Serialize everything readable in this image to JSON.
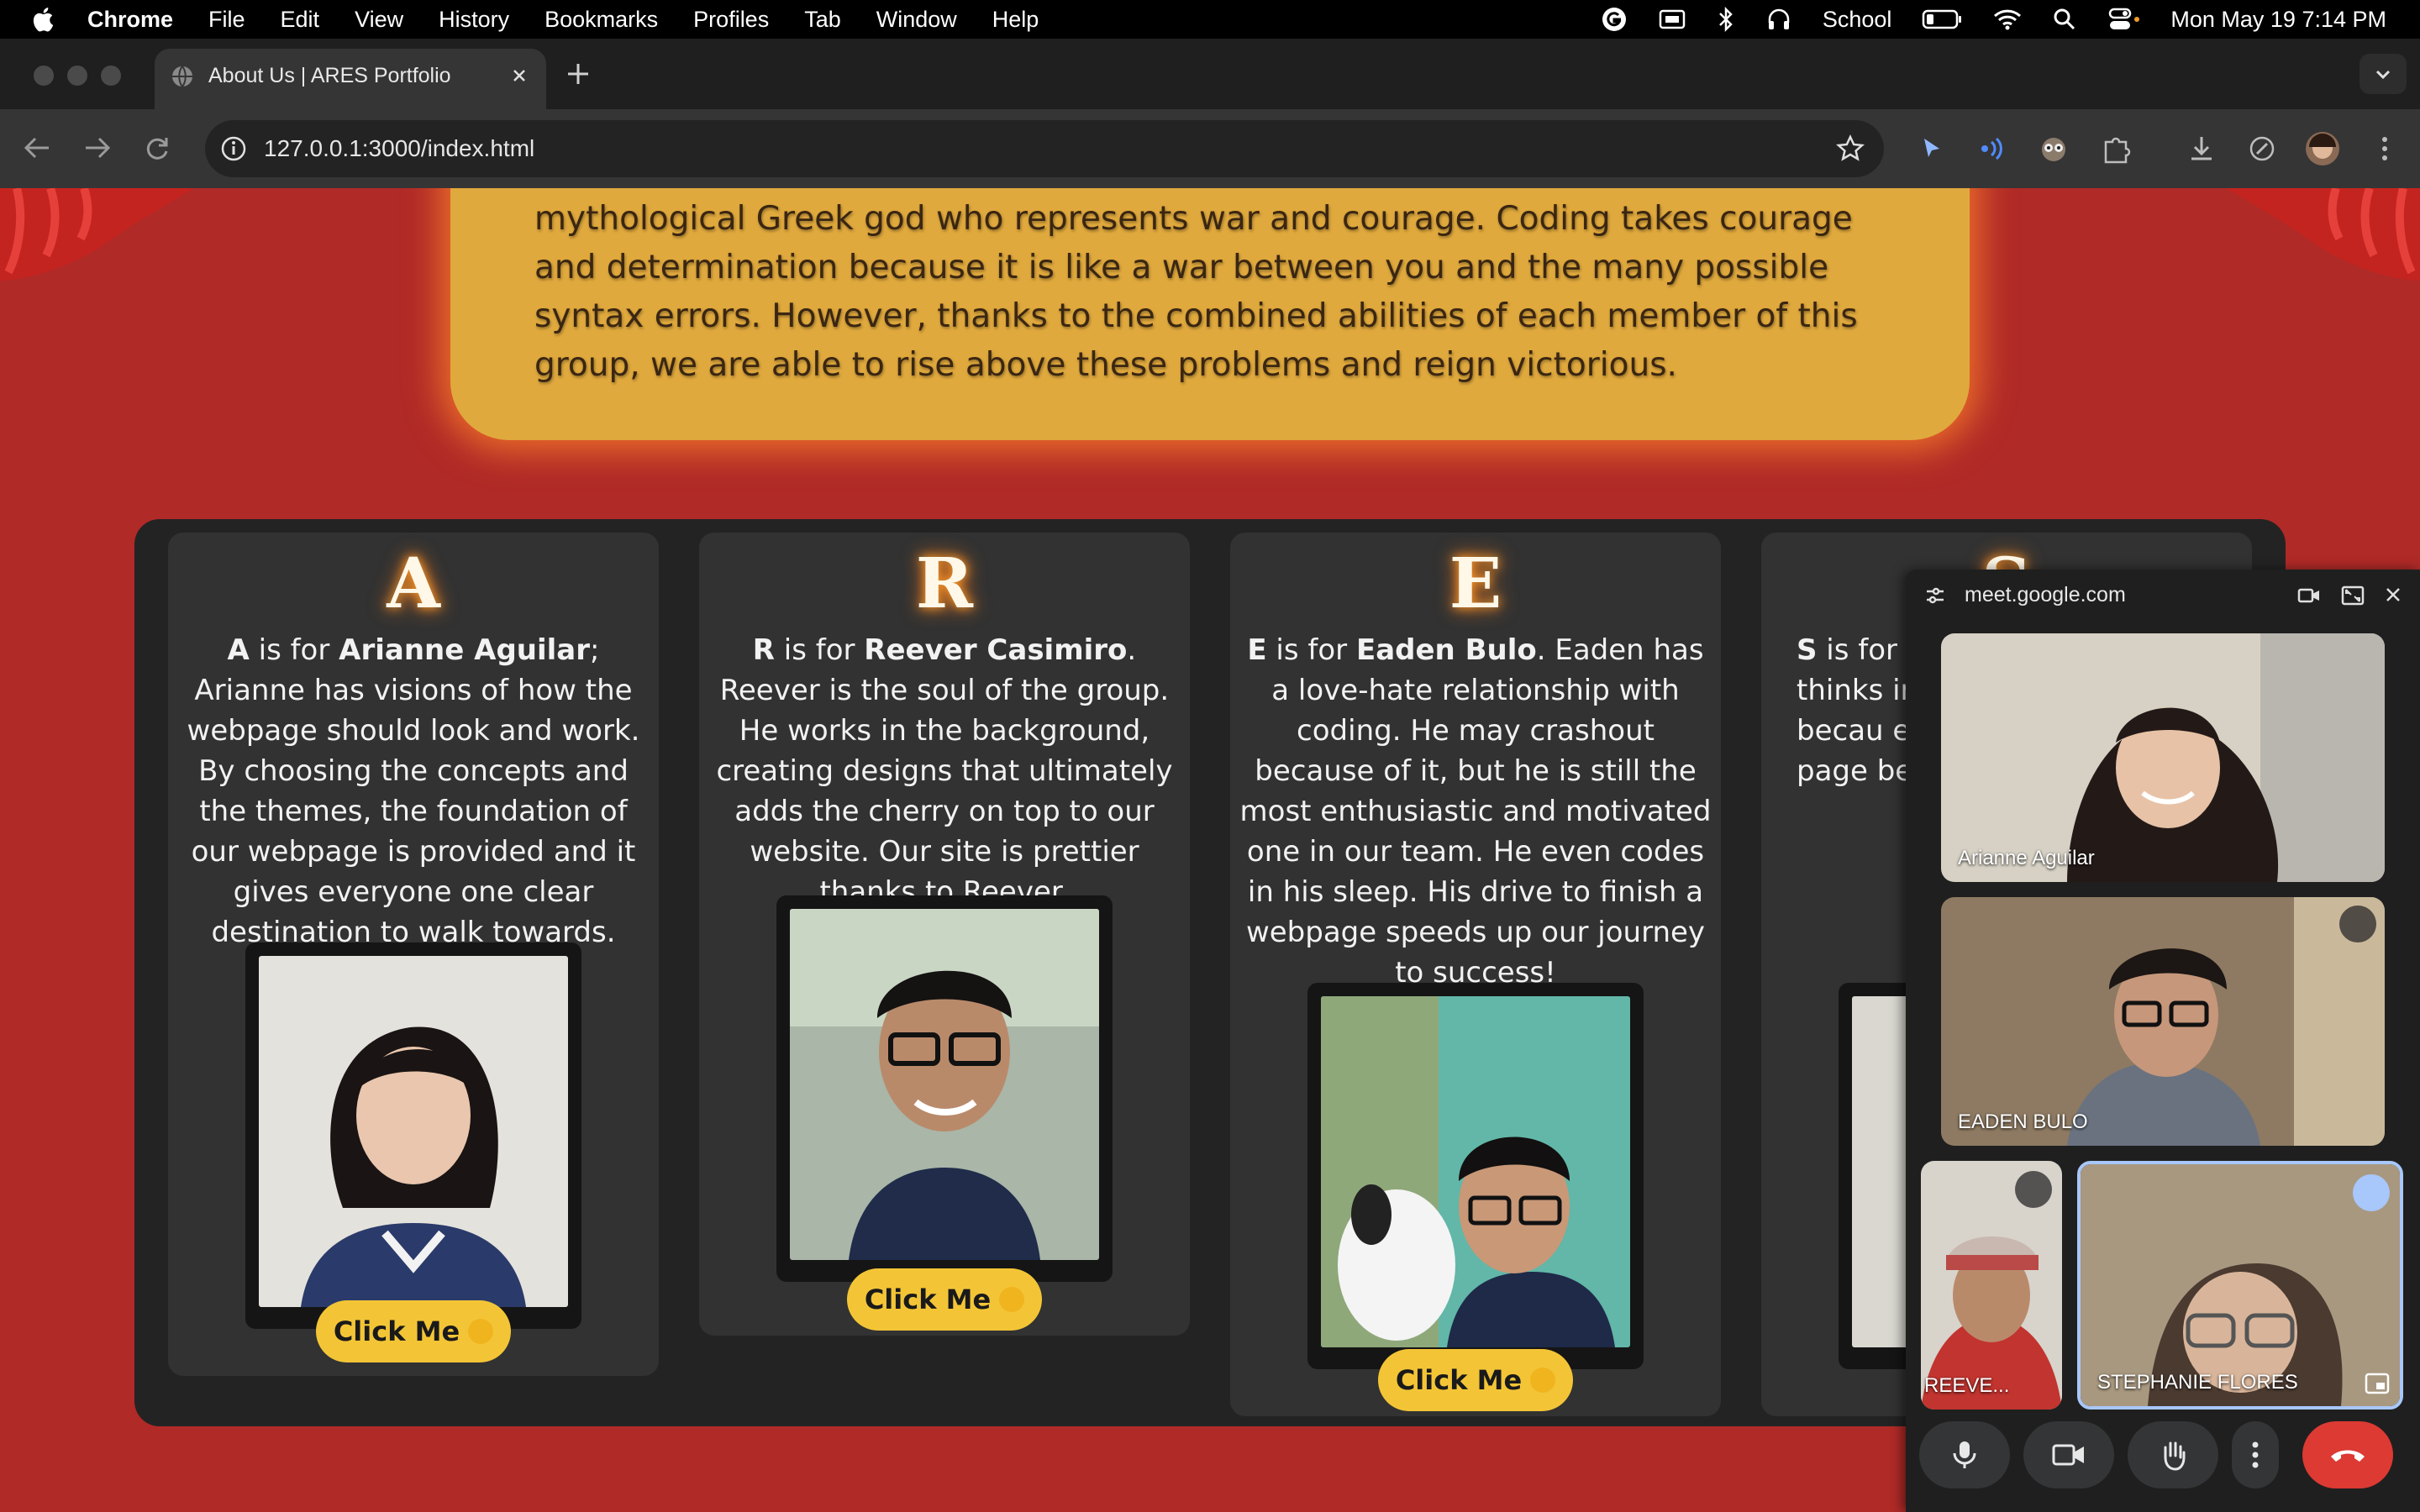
{
  "menubar": {
    "app": "Chrome",
    "items": [
      "File",
      "Edit",
      "View",
      "History",
      "Bookmarks",
      "Profiles",
      "Tab",
      "Window",
      "Help"
    ],
    "status_text": "School",
    "datetime": "Mon May 19  7:14 PM"
  },
  "browser": {
    "tab_title": "About Us | ARES Portfolio",
    "url": "127.0.0.1:3000/index.html"
  },
  "page": {
    "intro_text": "mythological Greek god who represents war and courage. Coding takes courage and determination because it is like a war between you and the many possible syntax errors. However, thanks to the combined abilities of each member of this group, we are able to rise above these problems and reign victorious.",
    "members": [
      {
        "letter": "A",
        "lead": "A",
        "mid": " is for ",
        "name": "Arianne Aguilar",
        "text": "; Arianne has visions of how the webpage should look and work. By choosing the concepts and the themes, the foundation of our webpage is provided and it gives everyone one clear destination to walk towards.",
        "button": "Click Me"
      },
      {
        "letter": "R",
        "lead": "R",
        "mid": " is for ",
        "name": "Reever Casimiro",
        "text": ". Reever is the soul of the group. He works in the background, creating designs that ultimately adds the cherry on top to our website. Our site is prettier thanks to Reever.",
        "button": "Click Me"
      },
      {
        "letter": "E",
        "lead": "E",
        "mid": " is for ",
        "name": "Eaden Bulo",
        "text": ". Eaden has a love-hate relationship with coding. He may crashout because of it, but he is still the most enthusiastic and motivated one in our team. He even codes in his sleep. His drive to finish a webpage speeds up our journey to success!",
        "button": "Click Me"
      },
      {
        "letter": "S",
        "lead": "S",
        "mid": " is for ",
        "name": "S",
        "text": "thinks in bi even b proble becau encounter solution. In page be",
        "button": ""
      }
    ]
  },
  "meet": {
    "site": "meet.google.com",
    "participants": [
      {
        "name": "Arianne Aguilar"
      },
      {
        "name": "EADEN BULO"
      },
      {
        "name": "REEVE..."
      },
      {
        "name": "STEPHANIE FLORES"
      }
    ]
  }
}
